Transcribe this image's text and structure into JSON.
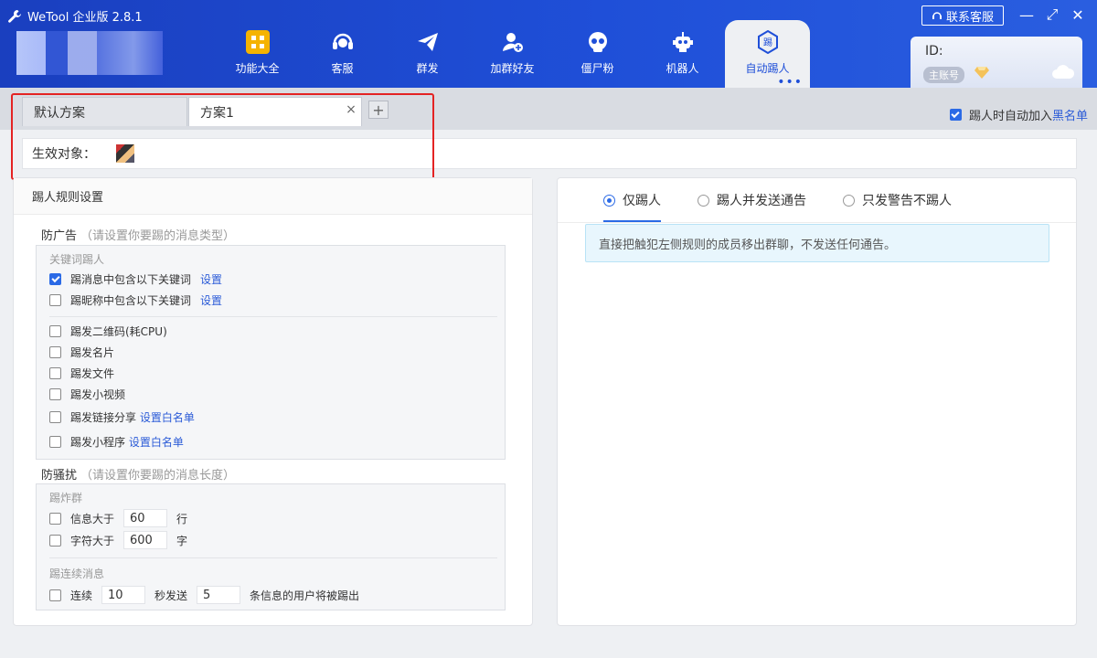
{
  "app": {
    "title": "WeTool 企业版 2.8.1"
  },
  "nav": [
    {
      "label": "功能大全",
      "icon": "apps-grid-icon"
    },
    {
      "label": "客服",
      "icon": "headset-icon"
    },
    {
      "label": "群发",
      "icon": "paper-plane-icon"
    },
    {
      "label": "加群好友",
      "icon": "add-user-icon"
    },
    {
      "label": "僵尸粉",
      "icon": "skull-icon"
    },
    {
      "label": "机器人",
      "icon": "robot-icon"
    },
    {
      "label": "自动踢人",
      "icon": "kick-badge-icon",
      "badge_char": "踢",
      "active": true
    }
  ],
  "window": {
    "contact_label": "联系客服",
    "min": "—",
    "max": "⤢",
    "close": "✕"
  },
  "account": {
    "id_label": "ID:",
    "badge": "主账号"
  },
  "schemes": {
    "tabs": [
      "默认方案",
      "方案1"
    ],
    "add_label": "+"
  },
  "auto_blacklist": {
    "label": "踢人时自动加入",
    "link": "黑名单",
    "checked": true
  },
  "target": {
    "label": "生效对象："
  },
  "left": {
    "title": "踢人规则设置",
    "anti_ad": {
      "head": "防广告",
      "hint": "（请设置你要踢的消息类型）",
      "keyword_sub": "关键词踢人",
      "keyword_rows": [
        {
          "label": "踢消息中包含以下关键词",
          "link": "设置",
          "checked": true
        },
        {
          "label": "踢昵称中包含以下关键词",
          "link": "设置",
          "checked": false
        }
      ],
      "type_rows": [
        {
          "label": "踢发二维码(耗CPU)",
          "link": ""
        },
        {
          "label": "踢发名片",
          "link": ""
        },
        {
          "label": "踢发文件",
          "link": ""
        },
        {
          "label": "踢发小视频",
          "link": ""
        },
        {
          "label": "踢发链接分享",
          "link": "设置白名单"
        },
        {
          "label": "踢发小程序",
          "link": "设置白名单"
        }
      ]
    },
    "anti_spam": {
      "head": "防骚扰",
      "hint": "（请设置你要踢的消息长度）",
      "bomb_sub": "踢炸群",
      "msg_row": {
        "prefix": "信息大于",
        "value": "60",
        "suffix": "行"
      },
      "char_row": {
        "prefix": "字符大于",
        "value": "600",
        "suffix": "字"
      },
      "cont_sub": "踢连续消息",
      "cont_row": {
        "prefix": "连续",
        "seconds": "10",
        "mid": "秒发送",
        "count": "5",
        "suffix": "条信息的用户将被踢出"
      }
    }
  },
  "right": {
    "modes": [
      {
        "label": "仅踢人",
        "selected": true
      },
      {
        "label": "踢人并发送通告",
        "selected": false
      },
      {
        "label": "只发警告不踢人",
        "selected": false
      }
    ],
    "info": "直接把触犯左侧规则的成员移出群聊，不发送任何通告。"
  },
  "colors": {
    "header": "#1f4fd8",
    "accent": "#2b6ae6",
    "highlight": "#e42323"
  }
}
